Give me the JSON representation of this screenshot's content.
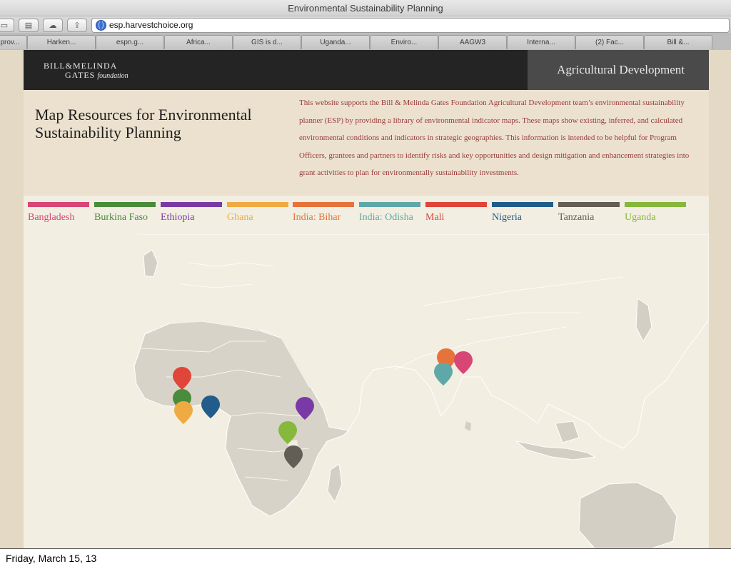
{
  "window": {
    "title": "Environmental Sustainability Planning"
  },
  "toolbar": {
    "url": "esp.harvestchoice.org"
  },
  "tabs": [
    "prov...",
    "Harken...",
    "espn.g...",
    "Africa...",
    "GIS is d...",
    "Uganda...",
    "Enviro...",
    "AAGW3",
    "Interna...",
    "(2) Fac...",
    "Bill &..."
  ],
  "header": {
    "logo_line1": "BILL&MELINDA",
    "logo_line2": "GATES",
    "logo_line2_sub": "foundation",
    "section": "Agricultural Development"
  },
  "intro": {
    "heading": "Map Resources for Environmental Sustainability Planning",
    "description": "This website supports the Bill & Melinda Gates Foundation Agricultural Development team’s environmental sustainability planner (ESP) by providing a library of environmental indicator maps. These maps show existing, inferred, and calculated environmental conditions and indicators in strategic geographies. This information is intended to be helpful for Program Officers, grantees and partners to identify risks and key opportunities and design mitigation and enhancement strategies into grant activities to plan for environmentally sustainability investments."
  },
  "countries": [
    {
      "name": "Bangladesh",
      "color": "#d84675"
    },
    {
      "name": "Burkina Faso",
      "color": "#4a8c3b"
    },
    {
      "name": "Ethiopia",
      "color": "#7a3aa6"
    },
    {
      "name": "Ghana",
      "color": "#f0aa42"
    },
    {
      "name": "India: Bihar",
      "color": "#e8733a"
    },
    {
      "name": "India: Odisha",
      "color": "#5fa8a8"
    },
    {
      "name": "Mali",
      "color": "#e0453a"
    },
    {
      "name": "Nigeria",
      "color": "#215c8a"
    },
    {
      "name": "Tanzania",
      "color": "#625d55"
    },
    {
      "name": "Uganda",
      "color": "#86b83b"
    }
  ],
  "footer": {
    "date": "Friday, March 15, 13"
  }
}
